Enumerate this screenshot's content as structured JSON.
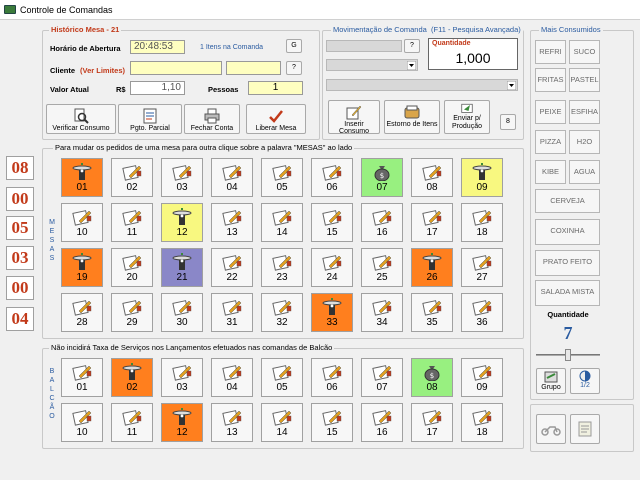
{
  "window": {
    "title": "Controle de Comandas"
  },
  "historico": {
    "legend": "Histórico Mesa - 21",
    "horario_label": "Horário de Abertura",
    "horario_value": "20:48:53",
    "itens_text": "1 Itens na Comanda",
    "g_button": "G",
    "cliente_label": "Cliente",
    "ver_limites": "(Ver Limites)",
    "cliente_value": "",
    "cliente_extra": "",
    "help_button": "?",
    "valor_label": "Valor Atual",
    "currency": "R$",
    "valor_value": "1,10",
    "pessoas_label": "Pessoas",
    "pessoas_value": "1",
    "buttons": [
      {
        "label": "Verificar Consumo",
        "icon": "magnifier-icon"
      },
      {
        "label": "Pgto. Parcial",
        "icon": "receipt-icon"
      },
      {
        "label": "Fechar Conta",
        "icon": "printer-icon"
      },
      {
        "label": "Liberar Mesa",
        "icon": "checkmark-icon"
      }
    ]
  },
  "movimentacao": {
    "legend": "Movimentação de Comanda",
    "hint": "(F11 - Pesquisa Avançada)",
    "quantidade_label": "Quantidade",
    "quantidade_value": "1,000",
    "help_button": "?",
    "buttons": [
      {
        "label": "Inserir Consumo",
        "icon": "pencil-note-icon"
      },
      {
        "label": "Estorno de Itens",
        "icon": "refund-icon"
      },
      {
        "label": "Enviar p/ Produção",
        "icon": "send-icon"
      }
    ],
    "eight_button": "8"
  },
  "mais_consumidos": {
    "legend": "Mais Consumidos",
    "items": [
      "REFRI",
      "SUCO",
      "FRITAS",
      "PASTEL",
      "PEIXE",
      "ESFIHA",
      "PIZZA",
      "H2O",
      "KIBE",
      "AGUA",
      "CERVEJA",
      "COXINHA",
      "PRATO FEITO",
      "SALADA MISTA"
    ],
    "quantidade_label": "Quantidade",
    "quantidade_value": "7",
    "grupo_label": "Grupo",
    "half_label": "1/2"
  },
  "counters": [
    "08",
    "00",
    "05",
    "03",
    "00",
    "04"
  ],
  "mesas": {
    "legend": "Para mudar os pedidos de uma mesa para outra clique sobre a palavra \"MESAS\" ao lado",
    "vertical_label": "M E S A S",
    "tiles": [
      {
        "n": "01",
        "state": "orange"
      },
      {
        "n": "02",
        "state": "empty"
      },
      {
        "n": "03",
        "state": "empty"
      },
      {
        "n": "04",
        "state": "empty"
      },
      {
        "n": "05",
        "state": "empty"
      },
      {
        "n": "06",
        "state": "empty"
      },
      {
        "n": "07",
        "state": "green"
      },
      {
        "n": "08",
        "state": "empty"
      },
      {
        "n": "09",
        "state": "yellow"
      },
      {
        "n": "10",
        "state": "empty"
      },
      {
        "n": "11",
        "state": "empty"
      },
      {
        "n": "12",
        "state": "yellow"
      },
      {
        "n": "13",
        "state": "empty"
      },
      {
        "n": "14",
        "state": "empty"
      },
      {
        "n": "15",
        "state": "empty"
      },
      {
        "n": "16",
        "state": "empty"
      },
      {
        "n": "17",
        "state": "empty"
      },
      {
        "n": "18",
        "state": "empty"
      },
      {
        "n": "19",
        "state": "orange"
      },
      {
        "n": "20",
        "state": "empty"
      },
      {
        "n": "21",
        "state": "purple"
      },
      {
        "n": "22",
        "state": "empty"
      },
      {
        "n": "23",
        "state": "empty"
      },
      {
        "n": "24",
        "state": "empty"
      },
      {
        "n": "25",
        "state": "empty"
      },
      {
        "n": "26",
        "state": "orange"
      },
      {
        "n": "27",
        "state": "empty"
      },
      {
        "n": "28",
        "state": "empty"
      },
      {
        "n": "29",
        "state": "empty"
      },
      {
        "n": "30",
        "state": "empty"
      },
      {
        "n": "31",
        "state": "empty"
      },
      {
        "n": "32",
        "state": "empty"
      },
      {
        "n": "33",
        "state": "orange"
      },
      {
        "n": "34",
        "state": "empty"
      },
      {
        "n": "35",
        "state": "empty"
      },
      {
        "n": "36",
        "state": "empty"
      }
    ]
  },
  "balcao": {
    "legend": "Não incidirá Taxa de Serviços nos Lançamentos efetuados nas comandas de Balcão",
    "vertical_label": "B A L C Ã O",
    "tiles": [
      {
        "n": "01",
        "state": "empty"
      },
      {
        "n": "02",
        "state": "orange"
      },
      {
        "n": "03",
        "state": "empty"
      },
      {
        "n": "04",
        "state": "empty"
      },
      {
        "n": "05",
        "state": "empty"
      },
      {
        "n": "06",
        "state": "empty"
      },
      {
        "n": "07",
        "state": "empty"
      },
      {
        "n": "08",
        "state": "green"
      },
      {
        "n": "09",
        "state": "empty"
      },
      {
        "n": "10",
        "state": "empty"
      },
      {
        "n": "11",
        "state": "empty"
      },
      {
        "n": "12",
        "state": "orange"
      },
      {
        "n": "13",
        "state": "empty"
      },
      {
        "n": "14",
        "state": "empty"
      },
      {
        "n": "15",
        "state": "empty"
      },
      {
        "n": "16",
        "state": "empty"
      },
      {
        "n": "17",
        "state": "empty"
      },
      {
        "n": "18",
        "state": "empty"
      }
    ]
  },
  "colors": {
    "orange": "#ff7f1e",
    "green": "#98f080",
    "yellow": "#f8f880",
    "purple": "#8a87c8",
    "counter_red": "#c23a1a",
    "label_blue": "#2a5ba0"
  }
}
